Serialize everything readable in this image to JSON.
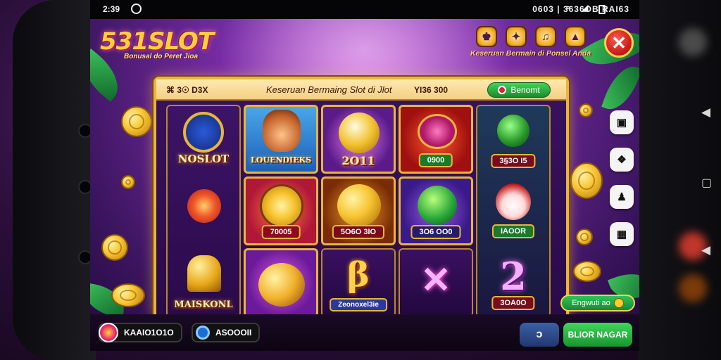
{
  "statusbar": {
    "time": "2:39",
    "right": "0603 | 3636OB RAI63"
  },
  "header": {
    "logo": "531SLOT",
    "logo_sub": "Bonusal do Peret Jioa",
    "caption": "Keseruan Bermain di Ponsel Anda",
    "icons": [
      "trophy-icon",
      "puzzle-icon",
      "gift-icon",
      "wallet-icon"
    ]
  },
  "panel": {
    "left_stat": "⌘ 3☉ D3X",
    "title": "Keseruan Bermaing Slot di Jlot",
    "right_stat": "YI36 300",
    "button_label": "Benomt"
  },
  "tiles": {
    "c1_r1": "NOSLOT",
    "c1_r3": "MAISKONL",
    "c2_r1": "LOUENDIEKS",
    "c2_r2": "70005",
    "c3_r1": "2O11",
    "c3_r2": "5O6O 3IO",
    "c3_r3": "Zeonoxel3ie",
    "c4_r1": "0900",
    "c4_r2": "3O6 OO0",
    "c5_r1": "3§3O I5",
    "c5_r2": "IAOOR",
    "c5_r3": "3OA0O",
    "big_two": "2"
  },
  "side": {
    "gold_button": "Engwuti ao"
  },
  "bottom": {
    "balance": "KAAIO1O1O",
    "coins": "ASOOOII",
    "back_label": "ɔ",
    "play_label": "BLIOR NAGAR"
  },
  "colors": {
    "accent_gold": "#e9b53c",
    "accent_green": "#2fc454",
    "close_red": "#d81d1d",
    "bg_purple": "#7a2ea8"
  }
}
